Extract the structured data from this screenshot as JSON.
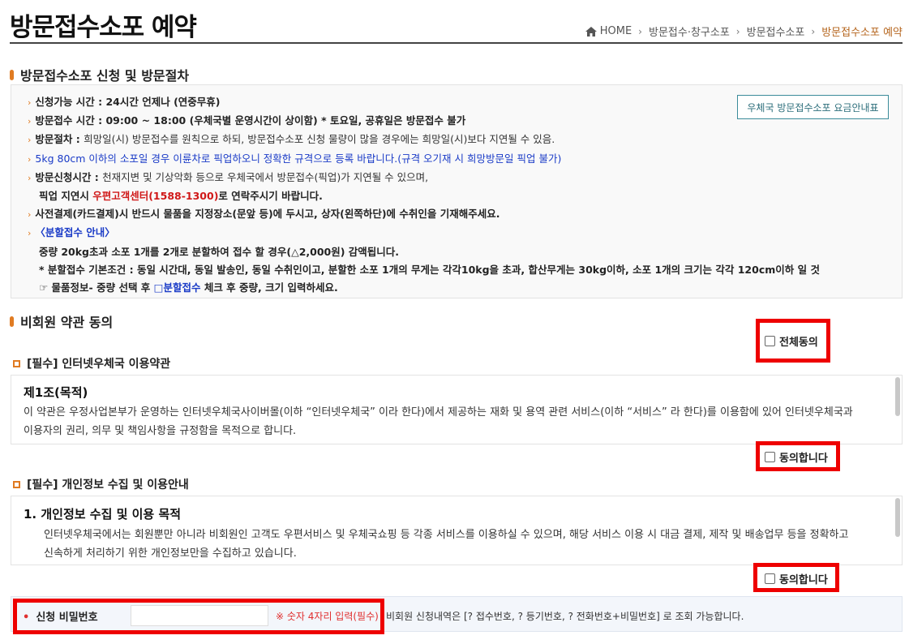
{
  "header": {
    "title": "방문접수소포 예약",
    "breadcrumb": [
      "HOME",
      "방문접수·창구소포",
      "방문접수소포",
      "방문접수소포 예약"
    ]
  },
  "section1": {
    "heading": "방문접수소포 신청 및 방문절차",
    "fee_button": "우체국 방문접수소포 요금안내표",
    "items": [
      {
        "label": "신청가능 시간 : ",
        "text": "24시간 언제나 (연중무휴)"
      },
      {
        "label": "방문접수 시간 : ",
        "text": "09:00 ~ 18:00 (우체국별 운영시간이 상이함) ",
        "extra": "* 토요일, 공휴일은 방문접수 불가"
      },
      {
        "label": "방문절차 : ",
        "text": "희망일(시) 방문접수를 원칙으로 하되, 방문접수소포 신청 물량이 많을 경우에는 희망일(시)보다 지연될 수 있음."
      },
      {
        "text": "5kg 80cm 이하의 소포일 경우 이륜차로 픽업하오니 정확한 규격으로 등록 바랍니다.(규격 오기재 시 희망방문일 픽업 불가)"
      },
      {
        "label": "방문신청시간 : ",
        "text": "천재지변 및 기상악화 등으로 우체국에서 방문접수(픽업)가 지연될 수 있으며,"
      },
      {
        "text_a": "픽업 지연시 ",
        "text_red": "우편고객센터(1588-1300)",
        "text_b": "로 연락주시기 바랍니다."
      },
      {
        "text": "사전결제(카드결제)시 반드시 물품을 지정장소(문앞 등)에 두시고, 상자(왼쪽하단)에 수취인을 기재해주세요."
      },
      {
        "text": "〈분할접수 안내〉"
      },
      {
        "text": "중량 20kg초과 소포 1개를 2개로 분할하여 접수 할 경우(△2,000원) 감액됩니다."
      },
      {
        "text": "* 분할접수 기본조건 : 동일 시간대, 동일 발송인, 동일 수취인이고, 분할한 소포 1개의 무게는 각각10kg을 초과, 합산무게는 30kg이하, 소포 1개의 크기는 각각 120cm이하 일 것"
      },
      {
        "text_a": "☞ 물품정보- 중량 선택 후 ",
        "text_blue": "□분할접수",
        "text_b": " 체크 후 중량, 크기 입력하세요."
      }
    ]
  },
  "section2": {
    "heading": "비회원 약관 동의",
    "agree_all": "전체동의",
    "terms1": {
      "heading": "[필수] 인터넷우체국 이용약관",
      "title": "제1조(목적)",
      "line1": "이 약관은 우정사업본부가 운영하는 인터넷우체국사이버몰(이하 “인터넷우체국” 이라 한다)에서 제공하는 재화 및 용역 관련 서비스(이하 “서비스” 라 한다)를 이용함에 있어 인터넷우체국과",
      "line2": "이용자의 권리, 의무 및 책임사항을 규정함을 목적으로 합니다.",
      "agree": "동의합니다"
    },
    "terms2": {
      "heading": "[필수] 개인정보 수집 및 이용안내",
      "title": "1. 개인정보 수집 및 이용 목적",
      "line1": "인터넷우체국에서는 회원뿐만 아니라 비회원인 고객도 우편서비스 및 우체국쇼핑 등 각종 서비스를 이용하실 수 있으며, 해당 서비스 이용 시 대금 결제, 제작 및 배송업무 등을 정확하고",
      "line2": "신속하게 처리하기 위한 개인정보만을 수집하고 있습니다.",
      "agree": "동의합니다"
    }
  },
  "password": {
    "label": "신청 비밀번호",
    "value": "",
    "hint": "※ 숫자 4자리 입력(필수)",
    "note": "비회원 신청내역은 [? 접수번호, ? 등기번호, ? 전화번호+비밀번호] 로 조회 가능합니다."
  },
  "colors": {
    "accent": "#e07b22",
    "highlight": "#ee0000",
    "breadcrumb_current": "#b5651d",
    "link_blue": "#1a3bc7",
    "emphasis_red": "#d01818"
  }
}
